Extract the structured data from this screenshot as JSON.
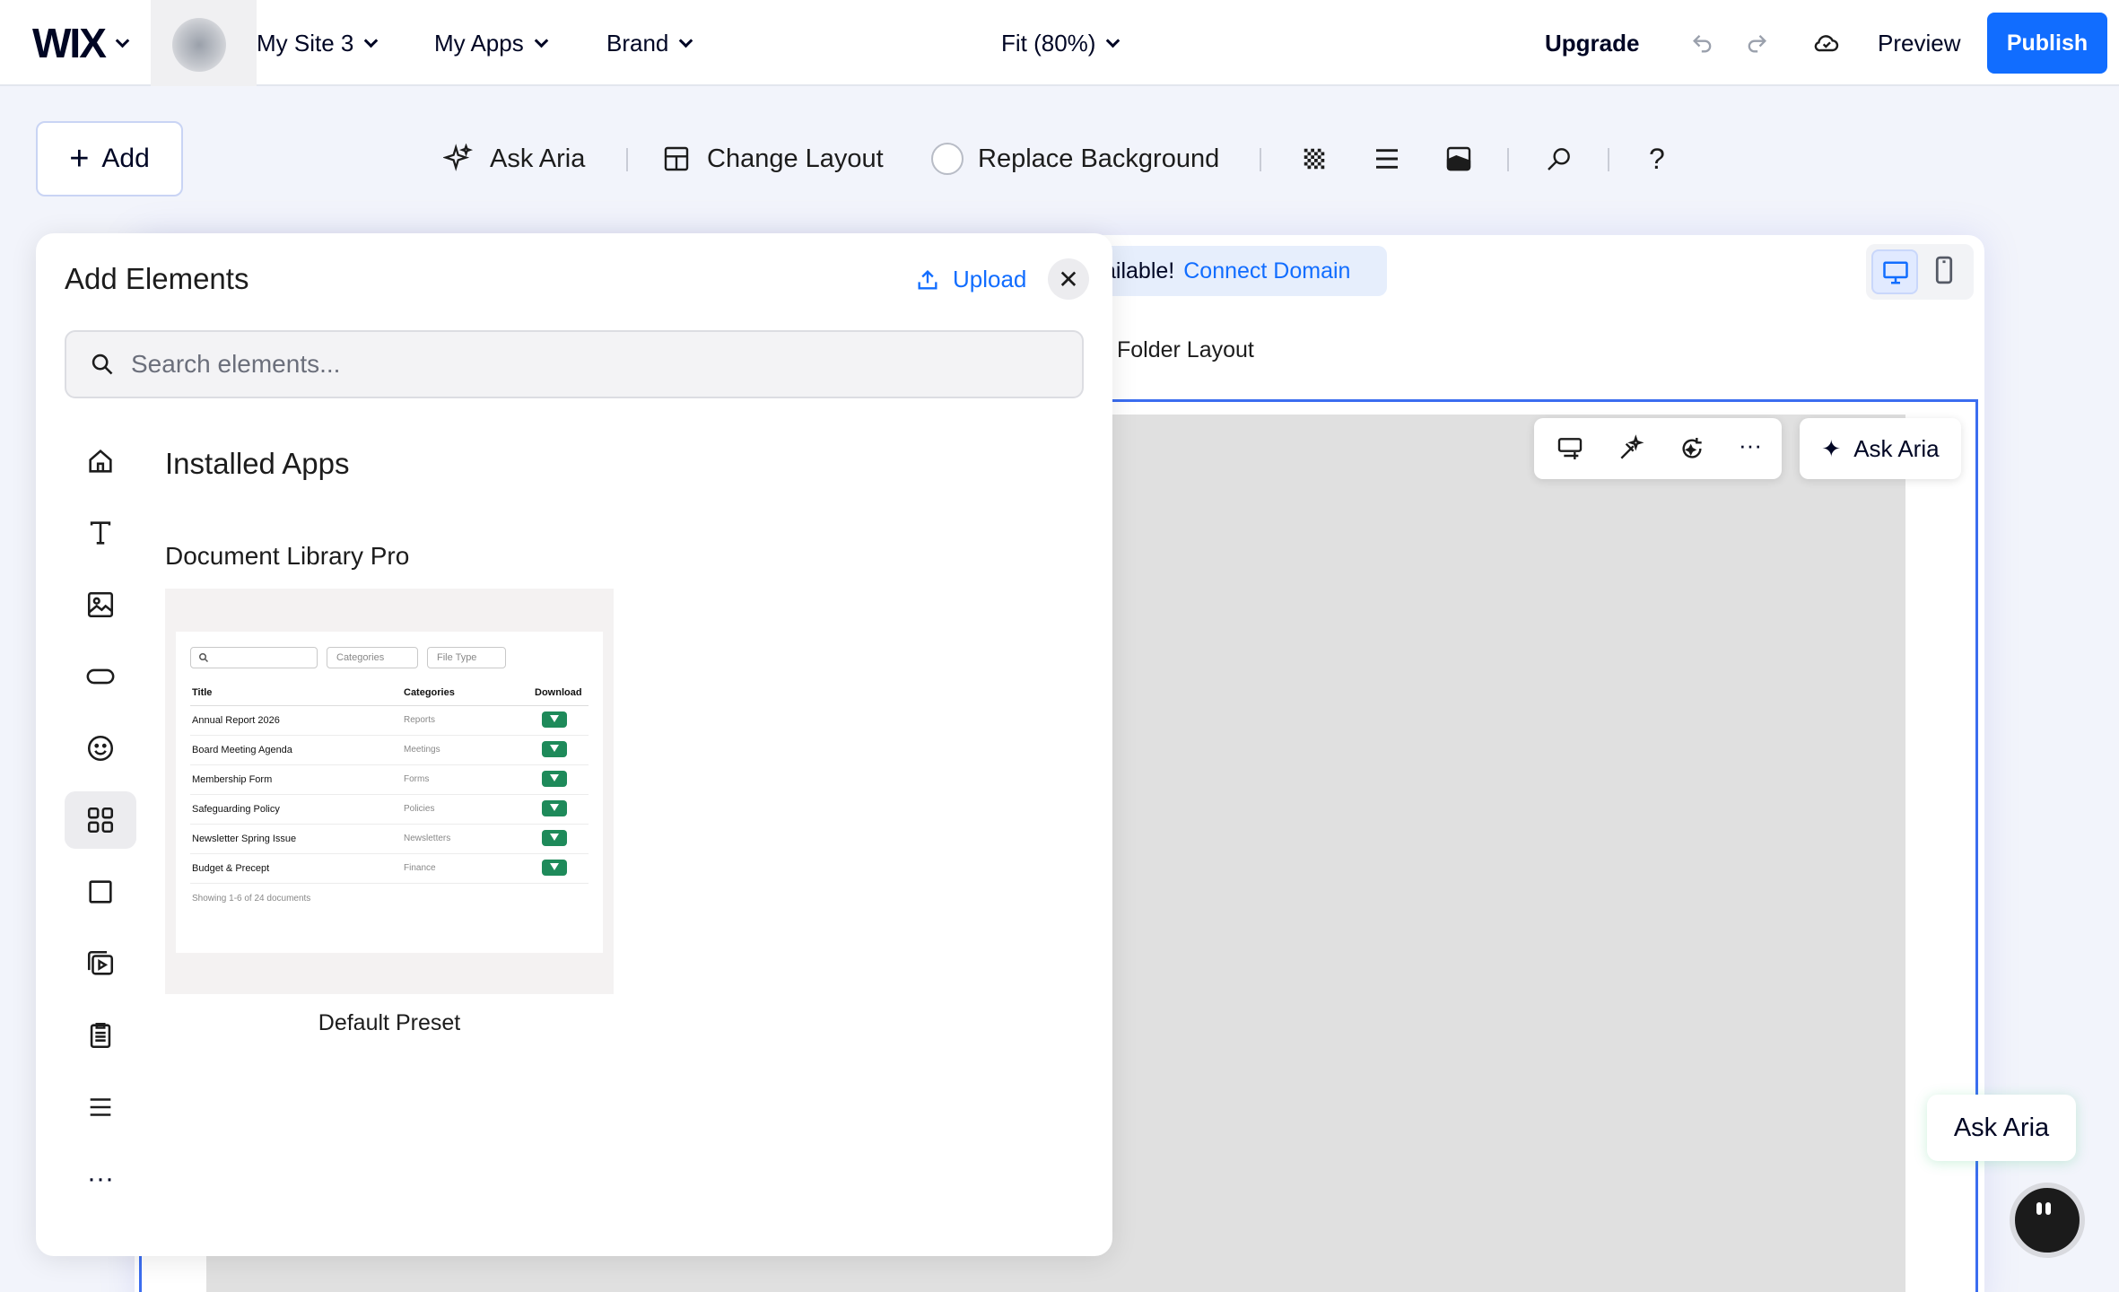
{
  "topbar": {
    "logo": "WIX",
    "site_menu": "My Site 3",
    "apps_menu": "My Apps",
    "brand_menu": "Brand",
    "zoom": "Fit (80%)",
    "upgrade": "Upgrade",
    "preview": "Preview",
    "publish": "Publish"
  },
  "toolbar": {
    "add": "Add",
    "ask_aria": "Ask Aria",
    "change_layout": "Change Layout",
    "replace_background": "Replace Background"
  },
  "canvas": {
    "domain_text": "ailable!",
    "domain_link": "Connect Domain",
    "folder_layout": "Folder Layout",
    "aria_chip": "Ask Aria",
    "aria_float": "Ask Aria"
  },
  "panel": {
    "title": "Add Elements",
    "upload": "Upload",
    "search_placeholder": "Search elements...",
    "section": "Installed Apps",
    "app_name": "Document Library Pro",
    "preset_label": "Default Preset",
    "categories": [
      "home-icon",
      "text-icon",
      "image-icon",
      "button-icon",
      "emoji-icon",
      "apps-icon",
      "box-icon",
      "video-icon",
      "clipboard-icon",
      "menu-icon",
      "more-icon"
    ],
    "active_category": "apps-icon"
  },
  "preview_table": {
    "search_box": "",
    "filter_categories": "Categories",
    "filter_type": "File Type",
    "headers": [
      "Title",
      "Categories",
      "Download"
    ],
    "rows": [
      {
        "title": "Annual Report 2026",
        "category": "Reports"
      },
      {
        "title": "Board Meeting Agenda",
        "category": "Meetings"
      },
      {
        "title": "Membership Form",
        "category": "Forms"
      },
      {
        "title": "Safeguarding Policy",
        "category": "Policies"
      },
      {
        "title": "Newsletter Spring Issue",
        "category": "Newsletters"
      },
      {
        "title": "Budget & Precept",
        "category": "Finance"
      }
    ],
    "footer": "Showing 1-6 of 24 documents"
  },
  "colors": {
    "accent": "#116dff",
    "selection": "#3b6df0",
    "download_green": "#1e8a5a"
  }
}
